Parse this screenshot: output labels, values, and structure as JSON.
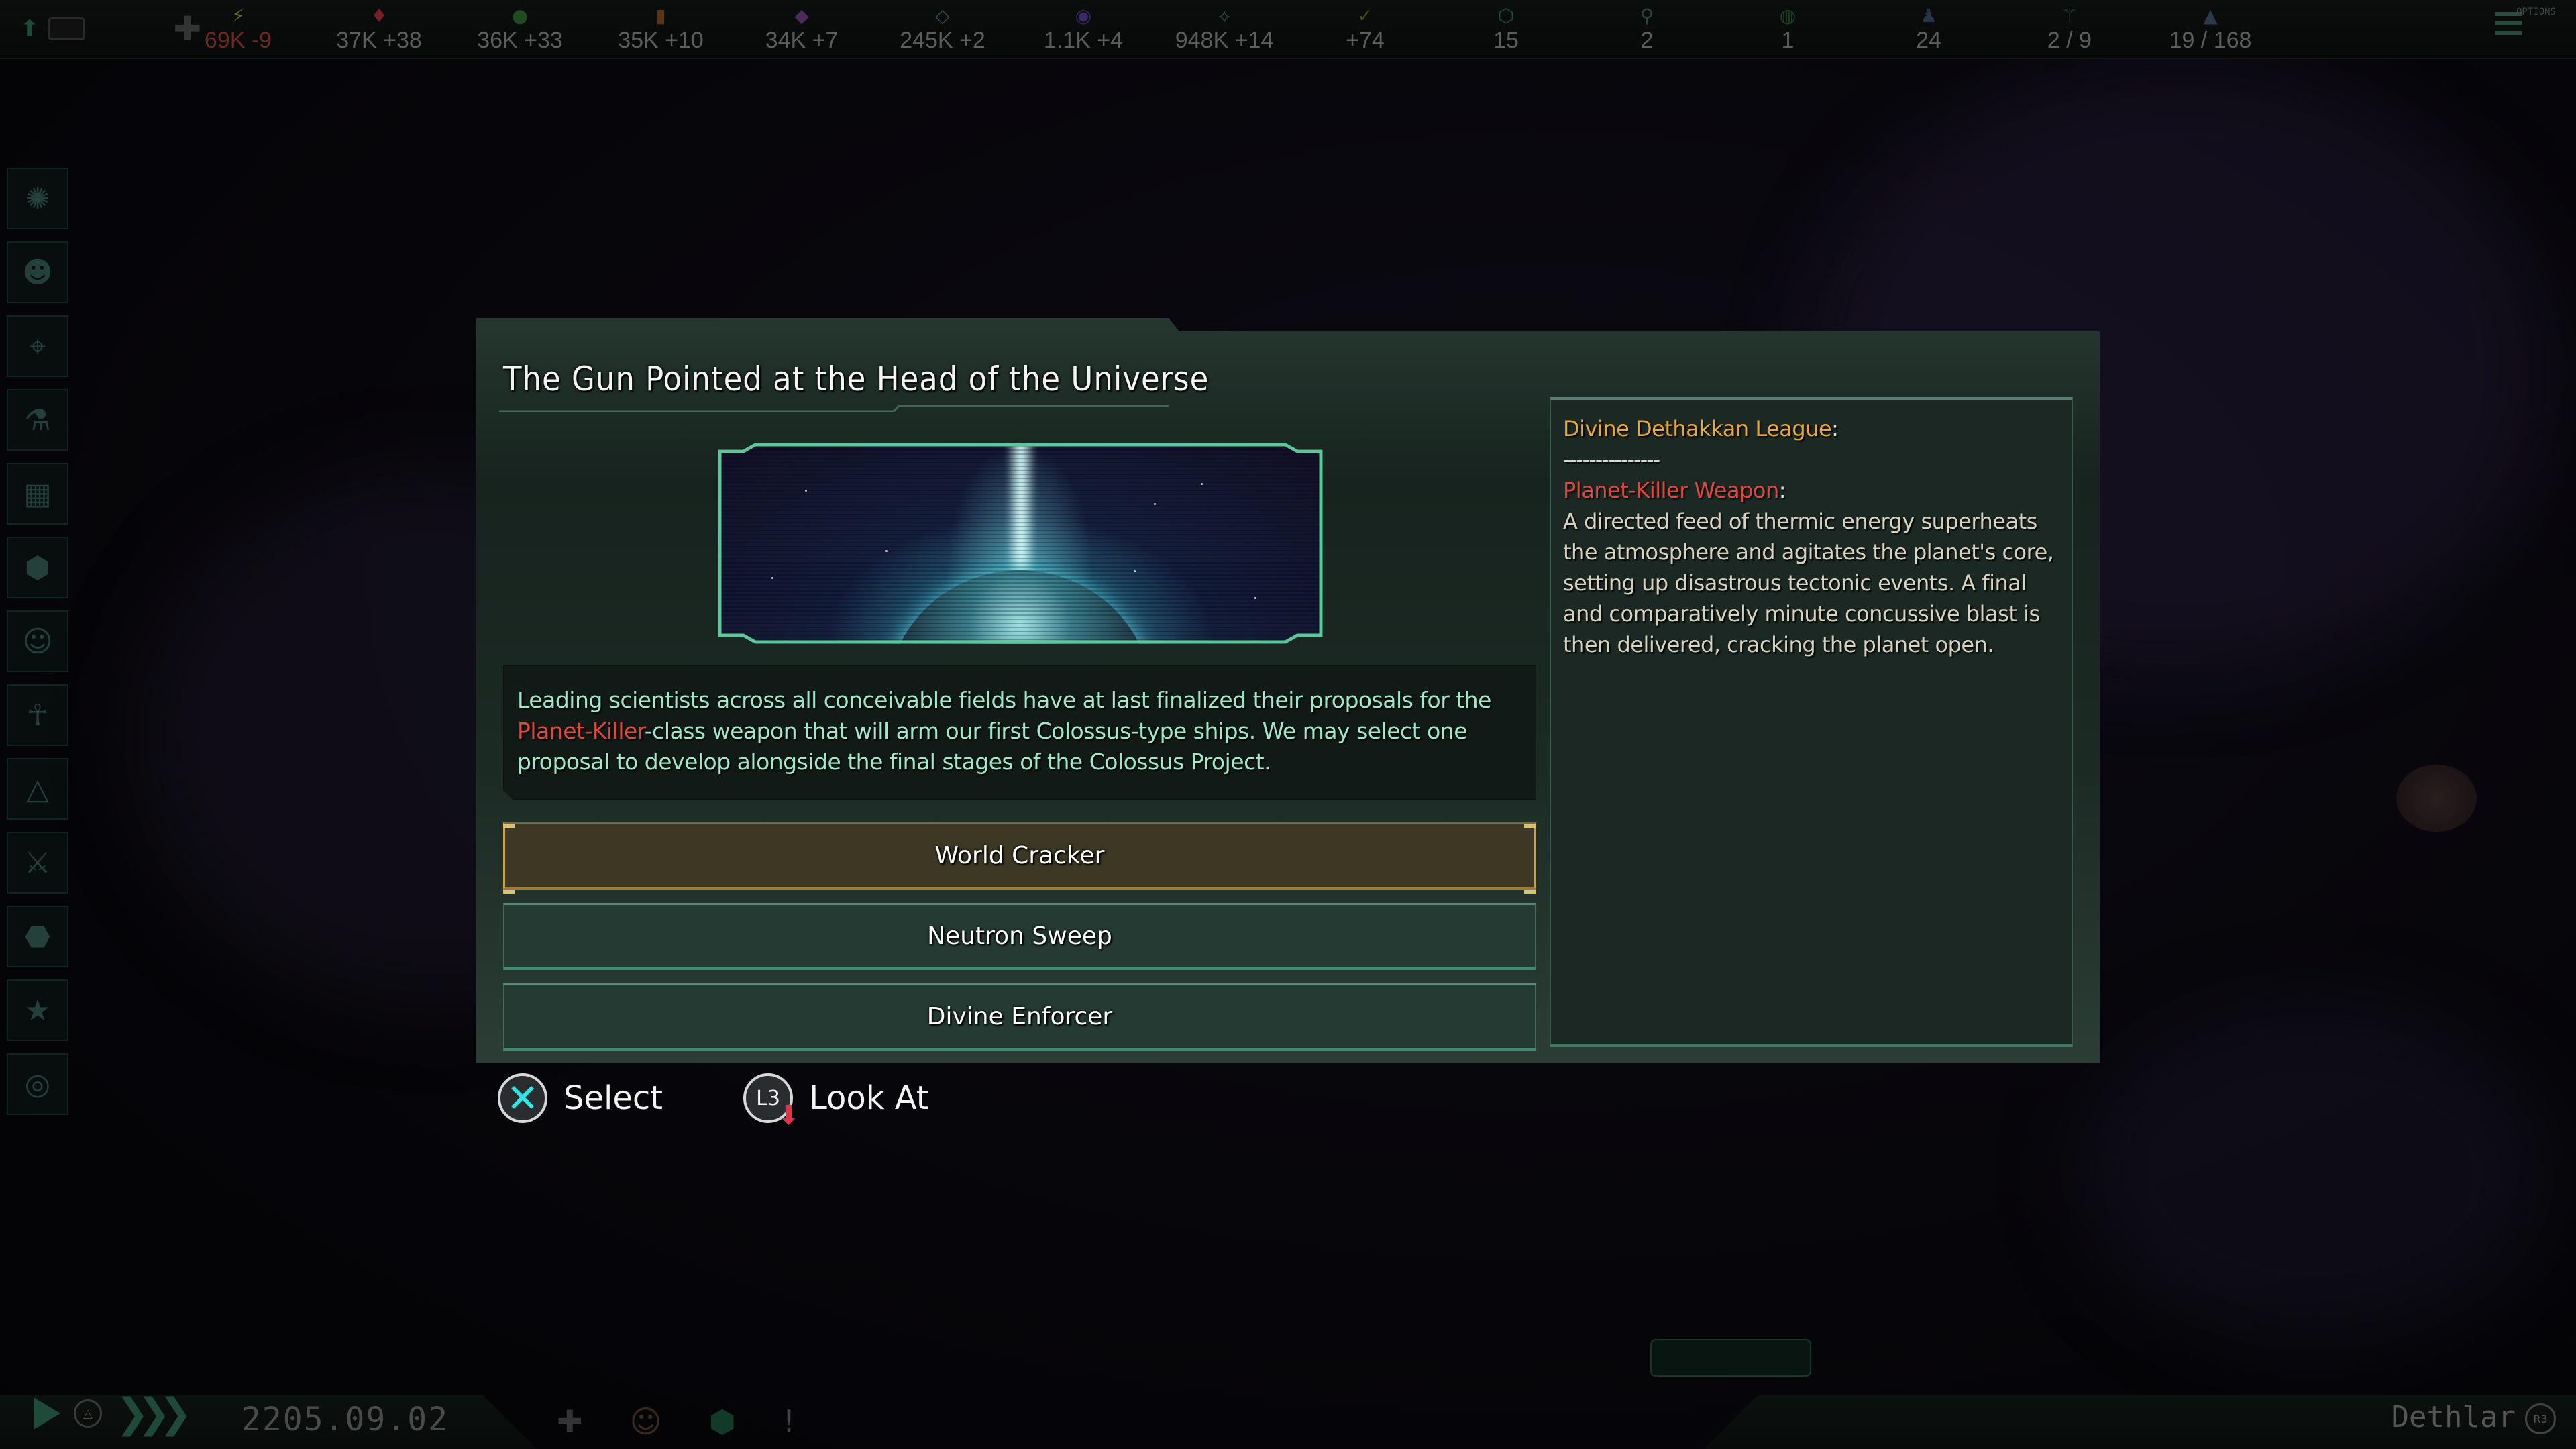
{
  "topbar": {
    "resources": [
      {
        "name": "energy",
        "icon": "⚡",
        "color": "#6b6320",
        "value": "69K -9",
        "negative": true
      },
      {
        "name": "minerals",
        "icon": "♦",
        "color": "#7a1e28",
        "value": "37K +38",
        "negative": false
      },
      {
        "name": "food",
        "icon": "●",
        "color": "#1f4a22",
        "value": "36K +33",
        "negative": false
      },
      {
        "name": "consumer-goods",
        "icon": "▮",
        "color": "#5a3414",
        "value": "35K +10",
        "negative": false
      },
      {
        "name": "alloys",
        "icon": "◆",
        "color": "#4a2c5a",
        "value": "34K +7",
        "negative": false
      },
      {
        "name": "influence",
        "icon": "◇",
        "color": "#2e4a52",
        "value": "245K +2",
        "negative": false
      },
      {
        "name": "unity",
        "icon": "◉",
        "color": "#3a2a66",
        "value": "1.1K +4",
        "negative": false
      },
      {
        "name": "research",
        "icon": "⟡",
        "color": "#2a4a44",
        "value": "948K +14",
        "negative": false
      },
      {
        "name": "trade",
        "icon": "✓",
        "color": "#4a4420",
        "value": "+74",
        "negative": false
      },
      {
        "name": "amenities",
        "icon": "⬡",
        "color": "#1e4a3a",
        "value": "15",
        "negative": false
      },
      {
        "name": "stability",
        "icon": "⚲",
        "color": "#2a4444",
        "value": "2",
        "negative": false
      },
      {
        "name": "planets",
        "icon": "◍",
        "color": "#1e4a22",
        "value": "1",
        "negative": false
      },
      {
        "name": "pops",
        "icon": "♟",
        "color": "#24344a",
        "value": "24",
        "negative": false
      },
      {
        "name": "starbases",
        "icon": "⚚",
        "color": "#1e4a26",
        "value": "2 / 9",
        "negative": false
      },
      {
        "name": "fleet-capacity",
        "icon": "▲",
        "color": "#2a3a4a",
        "value": "19 / 168",
        "negative": false
      }
    ],
    "options_label": "OPTIONS"
  },
  "sidebar": {
    "items": [
      {
        "name": "government",
        "icon": "✺"
      },
      {
        "name": "leaders",
        "icon": "☻"
      },
      {
        "name": "planets",
        "icon": "⌖"
      },
      {
        "name": "technology",
        "icon": "⚗"
      },
      {
        "name": "ship-designer",
        "icon": "▦"
      },
      {
        "name": "policies",
        "icon": "⬢"
      },
      {
        "name": "factions",
        "icon": "☺"
      },
      {
        "name": "species",
        "icon": "☥"
      },
      {
        "name": "fleets",
        "icon": "△"
      },
      {
        "name": "wars",
        "icon": "⚔"
      },
      {
        "name": "sectors",
        "icon": "⬣"
      },
      {
        "name": "traditions",
        "icon": "★"
      },
      {
        "name": "galaxy-map",
        "icon": "◎"
      }
    ]
  },
  "bottombar": {
    "date": "2205.09.02",
    "empire_name": "Dethlar",
    "r3_label": "R3"
  },
  "dialog": {
    "title": "The Gun Pointed at the Head of the Universe",
    "description": {
      "line_start": "Leading scientists across all conceivable fields have at last finalized their proposals for the ",
      "highlight": "Planet-Killer",
      "line_end": "-class weapon that will arm our first Colossus-type ships. We may select one proposal to develop alongside the final stages of the Colossus Project."
    },
    "options": [
      {
        "label": "World Cracker",
        "selected": true
      },
      {
        "label": "Neutron Sweep",
        "selected": false
      },
      {
        "label": "Divine Enforcer",
        "selected": false
      }
    ],
    "effect": {
      "faction": "Divine Dethakkan League",
      "separator": "---------------",
      "weapon": "Planet-Killer Weapon",
      "weapon_description": "A directed feed of thermic energy superheats the atmosphere and agitates the planet's core, setting up disastrous tectonic events. A final and comparatively minute concussive blast is then delivered, cracking the planet open."
    },
    "colors": {
      "accent_green": "#3d8a72",
      "selected_gold": "#c9a340",
      "highlight_red": "#e0493e",
      "faction_orange": "#e6a93a",
      "description_text": "#9fe8cc"
    }
  },
  "hints": [
    {
      "button": "✕",
      "label": "Select"
    },
    {
      "button": "L3",
      "label": "Look At"
    }
  ]
}
